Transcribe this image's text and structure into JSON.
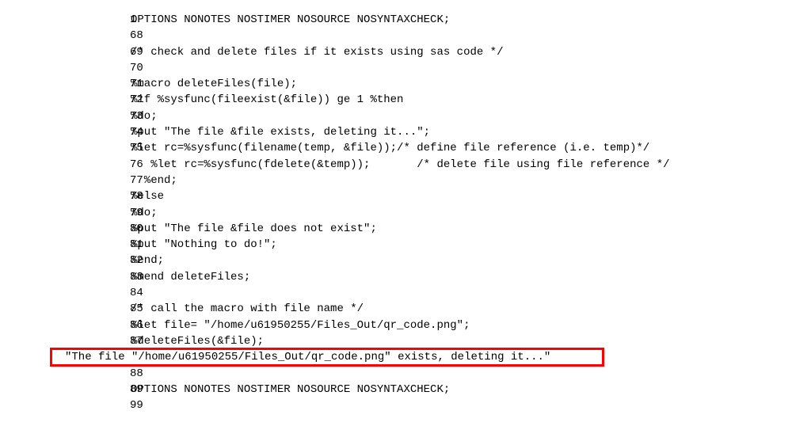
{
  "lines": [
    {
      "n": "1",
      "t": "OPTIONS NONOTES NOSTIMER NOSOURCE NOSYNTAXCHECK;"
    },
    {
      "n": "68",
      "t": ""
    },
    {
      "n": "69",
      "t": "/* check and delete files if it exists using sas code */"
    },
    {
      "n": "70",
      "t": ""
    },
    {
      "n": "71",
      "t": "%macro deleteFiles(file);"
    },
    {
      "n": "72",
      "t": "%if %sysfunc(fileexist(&file)) ge 1 %then"
    },
    {
      "n": "73",
      "t": "%do;"
    },
    {
      "n": "74",
      "t": "%put \"The file &file exists, deleting it...\";"
    },
    {
      "n": "75",
      "t": "%let rc=%sysfunc(filename(temp, &file));/* define file reference (i.e. temp)*/"
    },
    {
      "n": "76",
      "t": "   %let rc=%sysfunc(fdelete(&temp));       /* delete file using file reference */"
    },
    {
      "n": "77",
      "t": "  %end;"
    },
    {
      "n": "78",
      "t": "%else"
    },
    {
      "n": "79",
      "t": "%do;"
    },
    {
      "n": "80",
      "t": "%put \"The file &file does not exist\";"
    },
    {
      "n": "81",
      "t": "%put \"Nothing to do!\";"
    },
    {
      "n": "82",
      "t": "%end;"
    },
    {
      "n": "83",
      "t": "%mend deleteFiles;"
    },
    {
      "n": "84",
      "t": ""
    },
    {
      "n": "85",
      "t": "/* call the macro with file name */"
    },
    {
      "n": "86",
      "t": "%let file= \"/home/u61950255/Files_Out/qr_code.png\";"
    },
    {
      "n": "87",
      "t": "%deleteFiles(&file);"
    },
    {
      "n": "",
      "t": "\"The file \"/home/u61950255/Files_Out/qr_code.png\" exists, deleting it...\"",
      "special": "output"
    },
    {
      "n": "88",
      "t": ""
    },
    {
      "n": "89",
      "t": "OPTIONS NONOTES NOSTIMER NOSOURCE NOSYNTAXCHECK;"
    },
    {
      "n": "99",
      "t": ""
    }
  ],
  "highlight_line_index": 21
}
